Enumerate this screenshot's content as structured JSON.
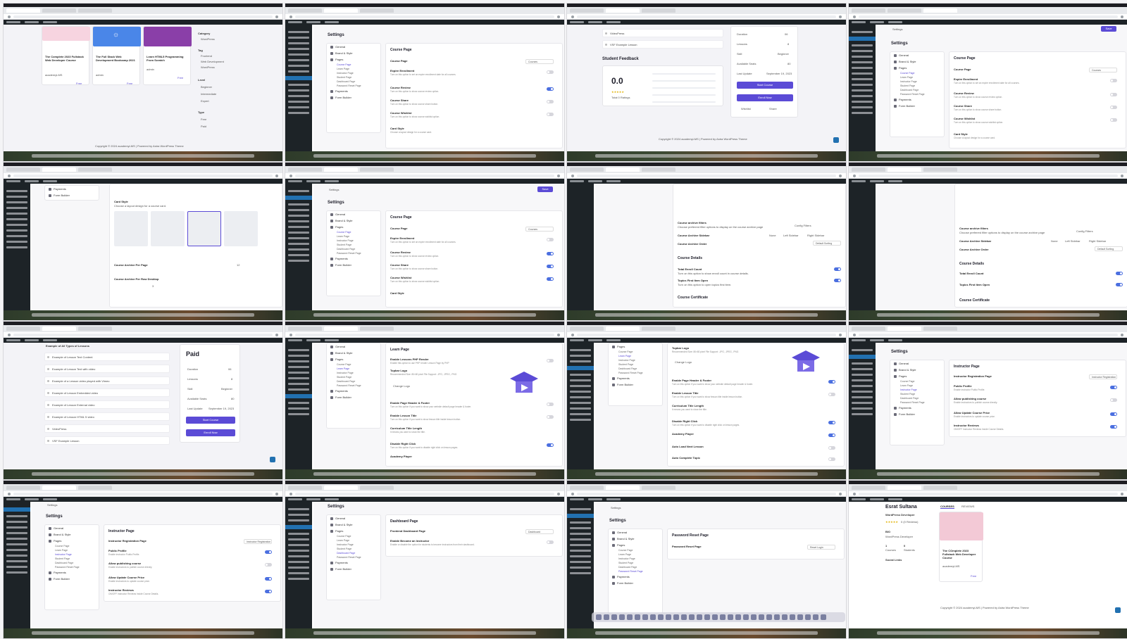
{
  "common": {
    "footer_copyright": "Copyright © 2024 academyLMS | Powered by Astra WordPress Theme"
  },
  "tile1": {
    "courses": [
      {
        "title": "The Complete 2023 Fullstack Web Developer Course",
        "author": "academyLMS",
        "price": "Free"
      },
      {
        "title": "The Full Stack Web Development Bootcamp 2021",
        "author": "admin",
        "price": "Free"
      },
      {
        "title": "Learn HTML5 Programming From Scratch",
        "author": "admin",
        "price": "Free"
      }
    ],
    "filters": {
      "category": "Category",
      "category_items": [
        "WordPress"
      ],
      "tag": "Tag",
      "tag_items": [
        "Frontend",
        "Web Development",
        "WordPress"
      ],
      "level": "Level",
      "level_items": [
        "Beginner",
        "Intermediate",
        "Expert"
      ],
      "type": "Type",
      "type_items": [
        "Free",
        "Paid"
      ]
    }
  },
  "settings": {
    "title": "Settings",
    "nav": [
      "General",
      "Brand & Style",
      "Pages",
      "Payments",
      "Form Builder"
    ],
    "pages_sub": [
      "Course Page",
      "Learn Page",
      "Instructor Page",
      "Student Page",
      "Dashboard Page",
      "Password Reset Page"
    ],
    "save": "Save"
  },
  "course_page": {
    "title": "Course Page",
    "rows": [
      {
        "label": "Course Page",
        "desc": "",
        "select": "Courses"
      },
      {
        "label": "Expire Enrollment",
        "desc": "Turn on this option to set an expire enrollment date for all courses."
      },
      {
        "label": "Course Review",
        "desc": "Turn on this option to show course review option."
      },
      {
        "label": "Course Share",
        "desc": "Turn on this option to show course share button."
      },
      {
        "label": "Course Wishlist",
        "desc": "Turn on this option to show course wishlist option."
      },
      {
        "label": "Card Style",
        "desc": "Choose a layout design for a course card."
      }
    ]
  },
  "feedback": {
    "title": "Student Feedback",
    "rating": "0.0",
    "total": "Total 0 Ratings",
    "lessons": [
      "VideoPress",
      "VSF Example Lesson"
    ],
    "side": [
      {
        "k": "Duration",
        "v": "06"
      },
      {
        "k": "Lessons",
        "v": "8"
      },
      {
        "k": "Skill",
        "v": "Beginner"
      },
      {
        "k": "Available Seats",
        "v": "80"
      },
      {
        "k": "Last Update",
        "v": "September 19, 2023"
      }
    ],
    "start": "Start Course",
    "enroll": "Enroll Now",
    "wishlist": "Wishlist",
    "share": "Share"
  },
  "card_style": {
    "title": "Card Style",
    "desc": "Choose a layout design for a course card.",
    "archive": "Course Archive Per Page",
    "archive_row": "Course Archive Per Row Desktop",
    "archive_val": "3",
    "per_page_val": "12"
  },
  "course_details": {
    "filters": "Course archive filters",
    "filters_desc": "Choose preferred filter options to display on the course archive page",
    "sidebar": "Course Archive Sidebar",
    "sidebar_opts": [
      "None",
      "Left Sidebar",
      "Right Sidebar"
    ],
    "order": "Course Archive Order",
    "order_val": "Default Sorting",
    "config": "Config Filters",
    "details": "Course Details",
    "enroll_count": "Total Enroll Count",
    "enroll_desc": "Turn on this option to show enroll count in course details.",
    "topics": "Topics First Item Open",
    "topics_desc": "Turn on this option to open topics first item.",
    "certificate": "Course Certificate"
  },
  "paid": {
    "heading": "Example of All Types of Lessons",
    "lessons": [
      "Example of Lesson Text Content",
      "Example of Lesson Text with video",
      "Example of a Lesson video played with Vimeo",
      "Example of Lesson Embedded video",
      "Example of Lesson External video",
      "Example of Lesson HTML 5 video",
      "VideoPress",
      "VSF Example Lesson"
    ],
    "price": "Paid",
    "side": [
      {
        "k": "Duration",
        "v": "06"
      },
      {
        "k": "Lessons",
        "v": "8"
      },
      {
        "k": "Skill",
        "v": "Beginner"
      },
      {
        "k": "Available Seats",
        "v": "80"
      },
      {
        "k": "Last Update",
        "v": "September 19, 2023"
      }
    ],
    "start": "Start Course",
    "enroll": "Enroll Now"
  },
  "learn_page": {
    "title": "Learn Page",
    "rows": [
      {
        "label": "Enable Lessons PHP Render",
        "desc": "Enable this option to use PHP render Lesson Page by PHP"
      },
      {
        "label": "Topbar Logo",
        "desc": "Recommended Size: 80×80 pixel  File Support: .JPG, .JPEG, .PNG"
      },
      {
        "label": "Enable Page Header & Footer",
        "desc": "Turn on this option if you want to show your website default page header & footer."
      },
      {
        "label": "Enable Lesson Title",
        "desc": "Turn on this option if you want to show lesson title inside lesson button."
      },
      {
        "label": "Curriculum Title Length",
        "desc": "It means you want to show the title."
      },
      {
        "label": "Disable Right Click",
        "desc": "Turn on this option if you want to disable right click on lesson pages."
      },
      {
        "label": "Academy Player",
        "desc": ""
      }
    ],
    "change": "Change Logo",
    "auto_load": "Auto Load Next Lesson",
    "auto_complete": "Auto Complete Topic"
  },
  "instructor_page": {
    "title": "Instructor Page",
    "reg": "Instructor Registration Page",
    "reg_val": "Instructor Registration",
    "rows": [
      {
        "label": "Public Profile",
        "desc": "Enable instructor Public Profile."
      },
      {
        "label": "Allow publishing course",
        "desc": "Enable instructors to publish course directly."
      },
      {
        "label": "Allow Update Course Price",
        "desc": "Enable instructors to update course price."
      },
      {
        "label": "Instructor Reviews",
        "desc": "ON/OFF Instructor Reviews Inside Course Details."
      }
    ]
  },
  "dashboard_page": {
    "title": "Dashboard Page",
    "row": "Frontend Dashboard Page",
    "val": "Dashboard",
    "become": "Enable Become an Instructor",
    "become_desc": "Enable or disable the option for students to become instructors from their dashboard."
  },
  "reset_page": {
    "title": "Password Reset Page",
    "row": "Password Reset Page",
    "val": "Reset Login"
  },
  "profile": {
    "name": "Esrat Sultana",
    "role": "WordPress Developer",
    "reviews": "0 (0 Reviews)",
    "bio": "BIO",
    "bio_text": "WordPress Developer",
    "courses_n": "1",
    "courses_l": "Courses",
    "students_n": "0",
    "students_l": "Students",
    "social": "Social Links",
    "tab1": "COURSES",
    "tab2": "REVIEWS",
    "course_title": "The COmplete 2023 Fullstack Web Developer Course",
    "course_author": "academyLMS",
    "course_price": "Free"
  }
}
